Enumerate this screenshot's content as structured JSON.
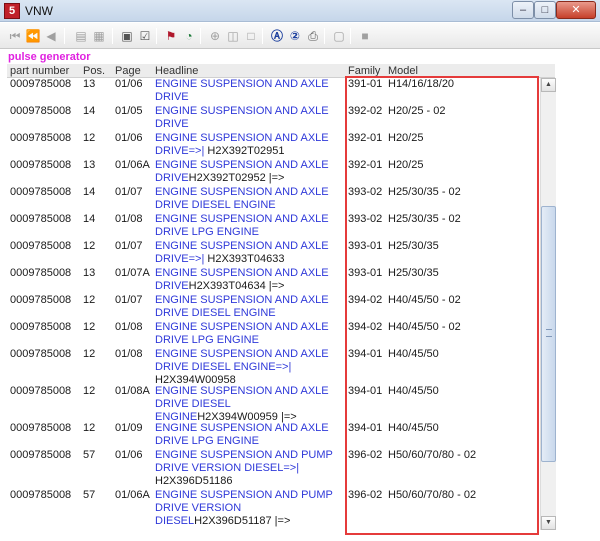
{
  "window": {
    "title": "VNW",
    "app_icon_glyph": "5"
  },
  "section_label": "pulse generator",
  "columns": {
    "part_number": "part number",
    "pos": "Pos.",
    "page": "Page",
    "headline": "Headline",
    "family": "Family",
    "model": "Model"
  },
  "rows": [
    {
      "part": "0009785008",
      "pos": "13",
      "page": "01/06",
      "head": "ENGINE SUSPENSION AND AXLE DRIVE",
      "head_suffix": "",
      "family": "391-01",
      "model": "H14/16/18/20"
    },
    {
      "part": "0009785008",
      "pos": "14",
      "page": "01/05",
      "head": "ENGINE SUSPENSION AND AXLE DRIVE",
      "head_suffix": "",
      "family": "392-02",
      "model": "H20/25 - 02"
    },
    {
      "part": "0009785008",
      "pos": "12",
      "page": "01/06",
      "head": "ENGINE SUSPENSION AND AXLE DRIVE=>|",
      "head_suffix": " H2X392T02951",
      "family": "392-01",
      "model": "H20/25"
    },
    {
      "part": "0009785008",
      "pos": "13",
      "page": "01/06A",
      "head": "ENGINE SUSPENSION AND AXLE DRIVE",
      "head_suffix": "H2X392T02952 |=>",
      "family": "392-01",
      "model": "H20/25"
    },
    {
      "part": "0009785008",
      "pos": "14",
      "page": "01/07",
      "head": "ENGINE SUSPENSION AND AXLE DRIVE DIESEL ENGINE",
      "head_suffix": "",
      "family": "393-02",
      "model": "H25/30/35 - 02"
    },
    {
      "part": "0009785008",
      "pos": "14",
      "page": "01/08",
      "head": "ENGINE SUSPENSION AND AXLE DRIVE LPG ENGINE",
      "head_suffix": "",
      "family": "393-02",
      "model": "H25/30/35 - 02"
    },
    {
      "part": "0009785008",
      "pos": "12",
      "page": "01/07",
      "head": "ENGINE SUSPENSION AND AXLE DRIVE=>|",
      "head_suffix": " H2X393T04633",
      "family": "393-01",
      "model": "H25/30/35"
    },
    {
      "part": "0009785008",
      "pos": "13",
      "page": "01/07A",
      "head": "ENGINE SUSPENSION AND AXLE DRIVE",
      "head_suffix": "H2X393T04634 |=>",
      "family": "393-01",
      "model": "H25/30/35"
    },
    {
      "part": "0009785008",
      "pos": "12",
      "page": "01/07",
      "head": "ENGINE SUSPENSION AND AXLE DRIVE DIESEL ENGINE",
      "head_suffix": "",
      "family": "394-02",
      "model": "H40/45/50 - 02"
    },
    {
      "part": "0009785008",
      "pos": "12",
      "page": "01/08",
      "head": "ENGINE SUSPENSION AND AXLE DRIVE LPG ENGINE",
      "head_suffix": "",
      "family": "394-02",
      "model": "H40/45/50 - 02"
    },
    {
      "part": "0009785008",
      "pos": "12",
      "page": "01/08",
      "head": "ENGINE SUSPENSION AND AXLE DRIVE DIESEL ENGINE=>|",
      "head_suffix": " H2X394W00958",
      "family": "394-01",
      "model": "H40/45/50"
    },
    {
      "part": "0009785008",
      "pos": "12",
      "page": "01/08A",
      "head": "ENGINE SUSPENSION AND AXLE DRIVE DIESEL ENGINE",
      "head_suffix": "H2X394W00959 |=>",
      "family": "394-01",
      "model": "H40/45/50"
    },
    {
      "part": "0009785008",
      "pos": "12",
      "page": "01/09",
      "head": "ENGINE SUSPENSION AND AXLE DRIVE LPG ENGINE",
      "head_suffix": "",
      "family": "394-01",
      "model": "H40/45/50"
    },
    {
      "part": "0009785008",
      "pos": "57",
      "page": "01/06",
      "head": "ENGINE SUSPENSION AND PUMP DRIVE VERSION DIESEL=>|",
      "head_suffix": " H2X396D51186",
      "family": "396-02",
      "model": "H50/60/70/80 - 02"
    },
    {
      "part": "0009785008",
      "pos": "57",
      "page": "01/06A",
      "head": "ENGINE SUSPENSION AND PUMP DRIVE VERSION DIESEL",
      "head_suffix": "H2X396D51187 |=>",
      "family": "396-02",
      "model": "H50/60/70/80 - 02"
    }
  ],
  "colors": {
    "headline": "#2f39d9",
    "section_label": "#e022e0",
    "highlight_border": "#e53b3b"
  },
  "toolbar_icons": [
    "first-page-icon",
    "previous-group-icon",
    "previous-page-icon",
    "book-back-icon",
    "book-forward-icon",
    "cart-icon",
    "checklist-icon",
    "tag-icon",
    "pie-chart-icon",
    "zoom-icon",
    "copy-icon",
    "page-icon",
    "circle-a-icon",
    "circle-2-icon",
    "print-icon",
    "clipboard-icon",
    "stop-icon"
  ]
}
